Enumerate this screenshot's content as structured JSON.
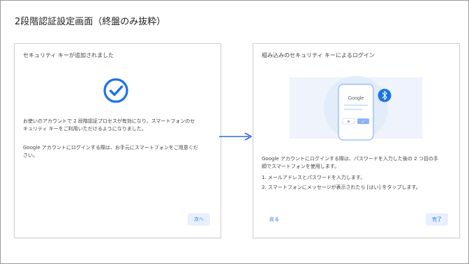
{
  "page": {
    "title": "2段階認証設定画面（終盤のみ抜粋）"
  },
  "left_card": {
    "title": "セキュリティ キーが追加されました",
    "body_lines": [
      "お使いのアカウントで 2 段階認証プロセスが有効になり、スマートフォンのセ",
      "キュリティ キーをご利用いただけるようになりました。"
    ],
    "note_lines": [
      "Google アカウントにログインする際は、お手元にスマートフォンをご用意くだ",
      "さい。"
    ],
    "next_button": "次へ"
  },
  "right_card": {
    "title": "組み込みのセキュリティ キーによるログイン",
    "illustration": {
      "logo": "Google",
      "bluetooth_icon": "bluetooth-icon",
      "cancel_glyph": "✕",
      "confirm_glyph": "✓"
    },
    "body_lines": [
      "Google アカウントにログインする際は、パスワードを入力した後の 2 つ目の手",
      "順でスマートフォンを使用します。"
    ],
    "steps": [
      "1. メールアドレスとパスワードを入力します。",
      "2. スマートフォンにメッセージが表示されたら [はい] をタップします。"
    ],
    "back_button": "戻る",
    "done_button": "完了"
  },
  "colors": {
    "accent": "#1a73e8",
    "button_bg": "#e8f0fe",
    "arrow": "#3367d6"
  }
}
